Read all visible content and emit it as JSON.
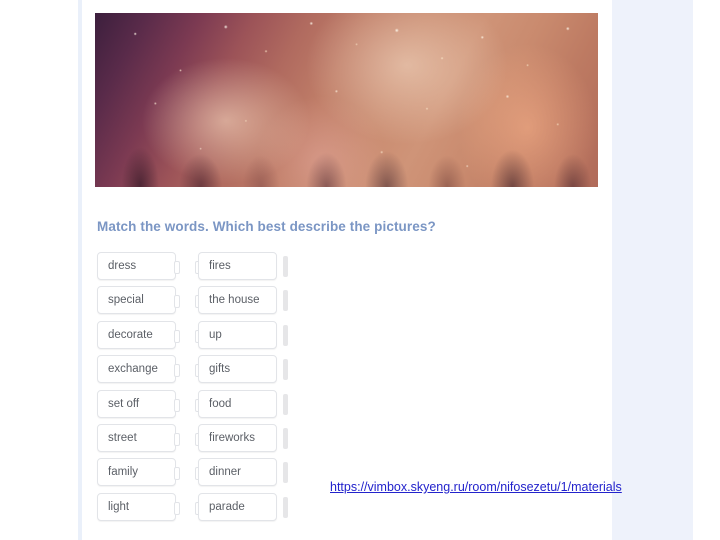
{
  "exercise": {
    "title": "Match the words. Which best describe the pictures?",
    "title_color": "#7b96c4",
    "pairs": [
      {
        "left": "dress",
        "right": "fires"
      },
      {
        "left": "special",
        "right": "the house"
      },
      {
        "left": "decorate",
        "right": "up"
      },
      {
        "left": "exchange",
        "right": "gifts"
      },
      {
        "left": "set off",
        "right": "food"
      },
      {
        "left": "street",
        "right": "fireworks"
      },
      {
        "left": "family",
        "right": "dinner"
      },
      {
        "left": "light",
        "right": "parade"
      }
    ]
  },
  "image": {
    "alt": "People celebrating with confetti at a party",
    "icon": "celebration-photo"
  },
  "link": {
    "text": "https://vimbox.skyeng.ru/room/nifosezetu/1/materials",
    "color": "#2323cc"
  },
  "theme": {
    "page_background": "#ffffff",
    "side_panel": "#eef2fb",
    "left_strip": "#eaf0fa",
    "box_border": "#e2e4e8",
    "box_text": "#5b5f66",
    "handle": "#e6e6e8"
  }
}
